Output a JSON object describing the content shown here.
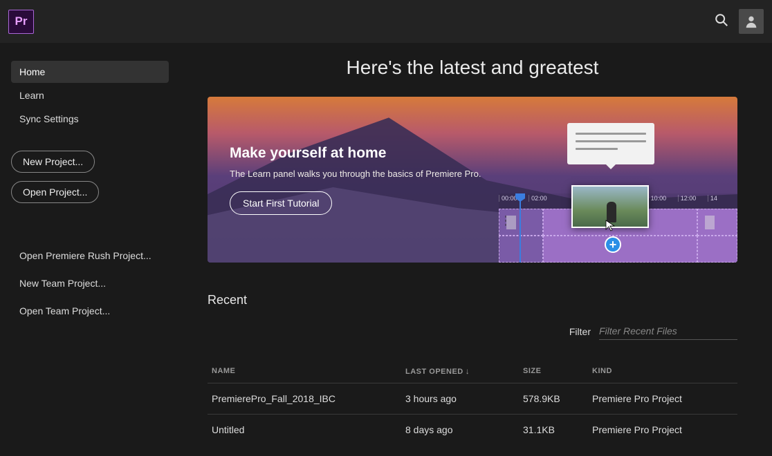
{
  "app": {
    "logo_text": "Pr"
  },
  "sidebar": {
    "nav": [
      {
        "label": "Home",
        "active": true
      },
      {
        "label": "Learn",
        "active": false
      },
      {
        "label": "Sync Settings",
        "active": false
      }
    ],
    "buttons": {
      "new_project": "New Project...",
      "open_project": "Open Project..."
    },
    "links": [
      "Open Premiere Rush Project...",
      "New Team Project...",
      "Open Team Project..."
    ]
  },
  "headline": "Here's the latest and greatest",
  "hero": {
    "title": "Make yourself at home",
    "subtitle": "The Learn panel walks you through the basics of Premiere Pro.",
    "cta": "Start First Tutorial",
    "timecodes": [
      "00:00",
      "02:00",
      "",
      "",
      "",
      "10:00",
      "12:00",
      "14"
    ]
  },
  "recent": {
    "heading": "Recent",
    "filter_label": "Filter",
    "filter_placeholder": "Filter Recent Files",
    "columns": {
      "name": "NAME",
      "last_opened": "LAST OPENED",
      "size": "SIZE",
      "kind": "KIND"
    },
    "sort_indicator": "↓",
    "rows": [
      {
        "name": "PremierePro_Fall_2018_IBC",
        "last_opened": "3 hours ago",
        "size": "578.9KB",
        "kind": "Premiere Pro Project"
      },
      {
        "name": "Untitled",
        "last_opened": "8 days ago",
        "size": "31.1KB",
        "kind": "Premiere Pro Project"
      }
    ]
  }
}
